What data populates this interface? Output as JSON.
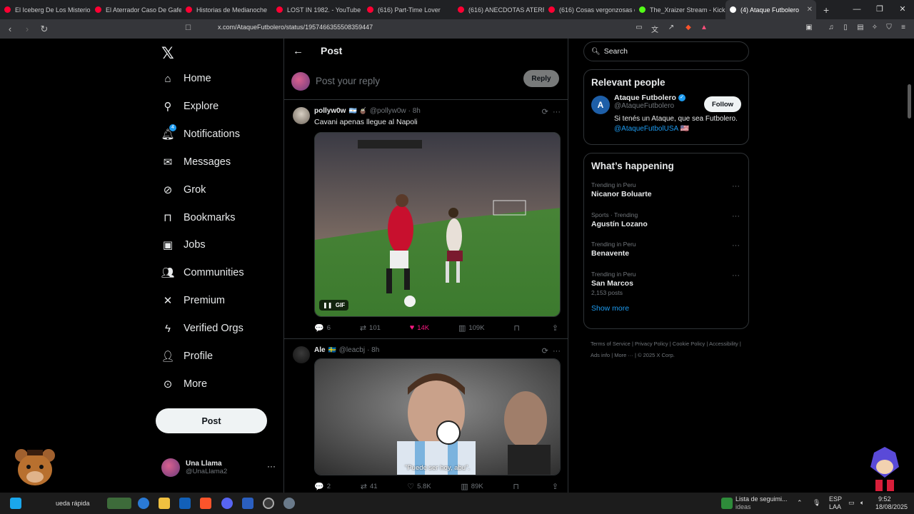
{
  "browser": {
    "tabs": [
      {
        "label": "El Iceberg De Los Misterio",
        "color": "#ff0033"
      },
      {
        "label": "El Aterrador Caso De Gafe",
        "color": "#ff0033"
      },
      {
        "label": "Historias de Medianoche",
        "color": "#ff0033"
      },
      {
        "label": "LOST IN 1982. - YouTube",
        "color": "#ff0033"
      },
      {
        "label": "(616) Part-Time Lover",
        "color": "#ff0033"
      },
      {
        "label": "(616) ANECDOTAS ATERR",
        "color": "#ff0033"
      },
      {
        "label": "(616) Cosas vergonzosas c",
        "color": "#ff0033"
      },
      {
        "label": "The_Xraizer Stream - Kick",
        "color": "#53fc18"
      },
      {
        "label": "(4) Ataque Futbolero",
        "color": "#ffffff"
      }
    ],
    "url": "x.com/AtaqueFutbolero/status/1957466355508359447"
  },
  "nav": {
    "items": [
      {
        "label": "Home",
        "icon": "home-icon"
      },
      {
        "label": "Explore",
        "icon": "search-icon"
      },
      {
        "label": "Notifications",
        "icon": "bell-icon",
        "badge": "4"
      },
      {
        "label": "Messages",
        "icon": "envelope-icon"
      },
      {
        "label": "Grok",
        "icon": "grok-icon"
      },
      {
        "label": "Bookmarks",
        "icon": "bookmark-icon"
      },
      {
        "label": "Jobs",
        "icon": "briefcase-icon"
      },
      {
        "label": "Communities",
        "icon": "people-icon"
      },
      {
        "label": "Premium",
        "icon": "x-icon"
      },
      {
        "label": "Verified Orgs",
        "icon": "lightning-icon"
      },
      {
        "label": "Profile",
        "icon": "person-icon"
      },
      {
        "label": "More",
        "icon": "more-circle-icon"
      }
    ],
    "post_label": "Post",
    "account": {
      "name": "Una Llama",
      "handle": "@UnaLlama2"
    }
  },
  "center": {
    "title": "Post",
    "reply_placeholder": "Post your reply",
    "reply_label": "Reply",
    "tweets": [
      {
        "name": "pollyw0w",
        "handle": "@pollyw0w",
        "time": "· 8h",
        "text": "Cavani apenas llegue al Napoli",
        "media_badge": "GIF",
        "replies": "6",
        "reposts": "101",
        "likes": "14K",
        "views": "109K"
      },
      {
        "name": "Ale",
        "handle": "@leacbj",
        "time": "· 8h",
        "text": "",
        "caption": "\"Puede ser hoy, abu\".",
        "replies": "2",
        "reposts": "41",
        "likes": "5.8K",
        "views": "89K"
      }
    ]
  },
  "right": {
    "search_placeholder": "Search",
    "relevant_title": "Relevant people",
    "person": {
      "name": "Ataque Futbolero",
      "handle": "@AtaqueFutbolero",
      "follow_label": "Follow",
      "bio": "Si tenés un Ataque, que sea Futbolero.",
      "bio_link": "@AtaqueFutbolUSA"
    },
    "happening_title": "What’s happening",
    "trends": [
      {
        "meta": "Trending in Peru",
        "title": "Nicanor Boluarte",
        "count": ""
      },
      {
        "meta": "Sports · Trending",
        "title": "Agustín Lozano",
        "count": ""
      },
      {
        "meta": "Trending in Peru",
        "title": "Benavente",
        "count": ""
      },
      {
        "meta": "Trending in Peru",
        "title": "San Marcos",
        "count": "2,153 posts"
      }
    ],
    "show_more": "Show more",
    "footer": [
      "Terms of Service",
      "Privacy Policy",
      "Cookie Policy",
      "Accessibility",
      "Ads info",
      "More ···",
      "© 2025 X Corp."
    ]
  },
  "taskbar": {
    "search_text": "ueda rápida",
    "watchlist_title": "Lista de seguimi...",
    "watchlist_sub": "ideas",
    "lang": "ESP",
    "lang_sub": "LAA",
    "time": "9:52",
    "date": "18/08/2025"
  }
}
